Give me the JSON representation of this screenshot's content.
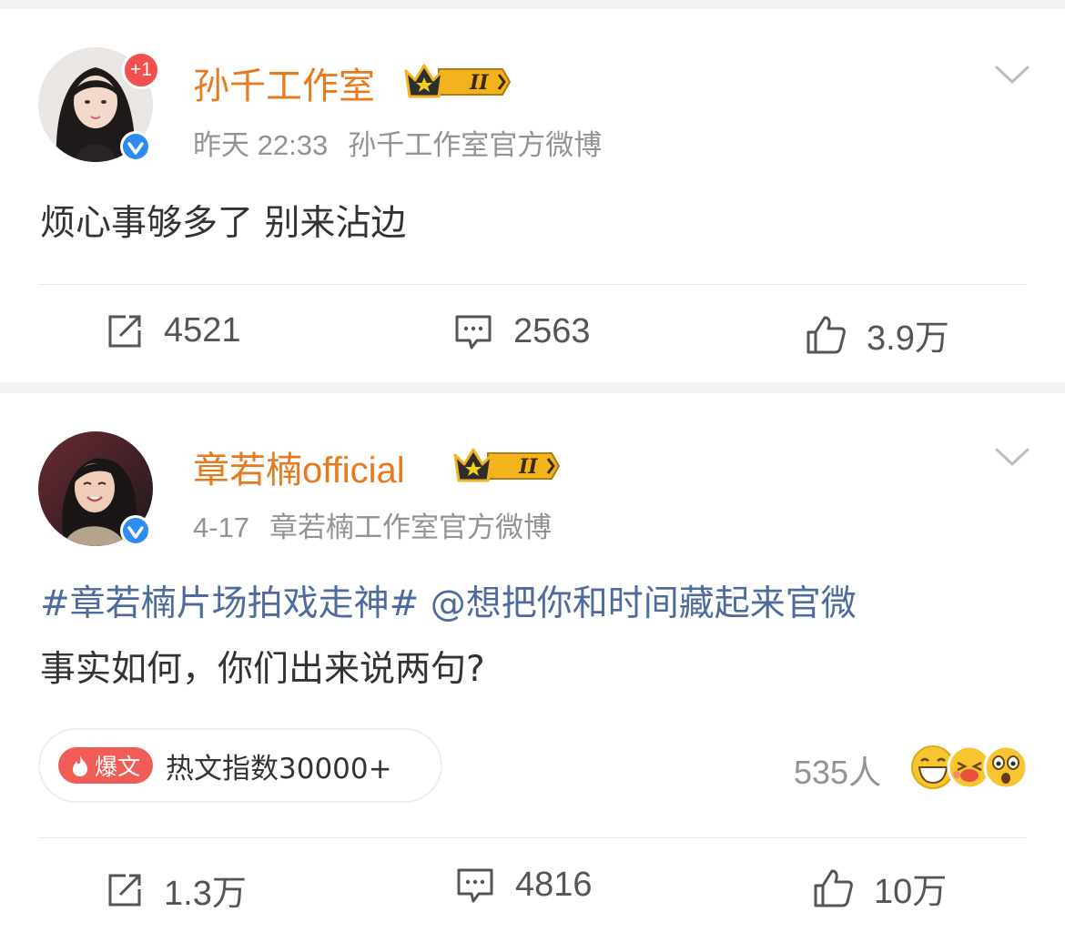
{
  "posts": [
    {
      "author": "孙千工作室",
      "unread_badge": "+1",
      "time": "昨天 22:33",
      "source": "孙千工作室官方微博",
      "content_line1": "烦心事够多了 别来沾边",
      "reposts": "4521",
      "comments": "2563",
      "likes": "3.9万"
    },
    {
      "author": "章若楠official",
      "time": "4-17",
      "source": "章若楠工作室官方微博",
      "content_topic": "#章若楠片场拍戏走神#",
      "content_mention": "@想把你和时间藏起来官微",
      "content_line2": "事实如何，你们出来说两句?",
      "hot_tag": "爆文",
      "hot_text": "热文指数30000+",
      "reaction_count": "535人",
      "reposts": "1.3万",
      "comments": "4816",
      "likes": "10万"
    }
  ],
  "colors": {
    "author": "#e8791d",
    "topic": "#4f6b9d",
    "meta": "#939393",
    "hot_tag": "#f25c57"
  },
  "icons": [
    "verified-icon",
    "crown-icon",
    "chevron-down-icon",
    "repost-icon",
    "comment-icon",
    "like-icon",
    "fire-icon",
    "laugh-emoji-icon",
    "blush-emoji-icon",
    "surprise-emoji-icon"
  ]
}
